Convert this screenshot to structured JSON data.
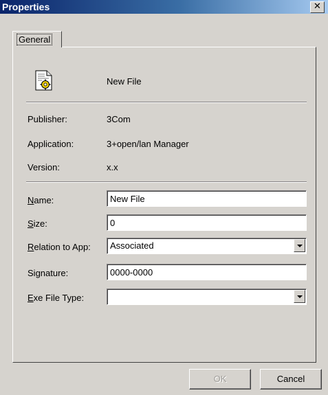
{
  "window": {
    "title": "Properties",
    "close_glyph": "✕"
  },
  "tabs": [
    {
      "label": "General",
      "selected": true
    }
  ],
  "file": {
    "icon": "document-gear-icon",
    "name": "New File"
  },
  "info": {
    "publisher_label": "Publisher:",
    "publisher_value": "3Com",
    "application_label": "Application:",
    "application_value": "3+open/lan Manager",
    "version_label": "Version:",
    "version_value": "x.x"
  },
  "form": {
    "name": {
      "label_u": "N",
      "label_rest": "ame:",
      "value": "New File"
    },
    "size": {
      "label_u": "S",
      "label_rest": "ize:",
      "value": "0"
    },
    "relation": {
      "label_u": "R",
      "label_rest": "elation to App:",
      "value": "Associated"
    },
    "signature": {
      "label_pre": "Si",
      "label_u": "g",
      "label_rest": "nature:",
      "value": "0000-0000"
    },
    "exe_type": {
      "label_u": "E",
      "label_rest": "xe File Type:",
      "value": ""
    }
  },
  "buttons": {
    "ok": "OK",
    "cancel": "Cancel"
  }
}
